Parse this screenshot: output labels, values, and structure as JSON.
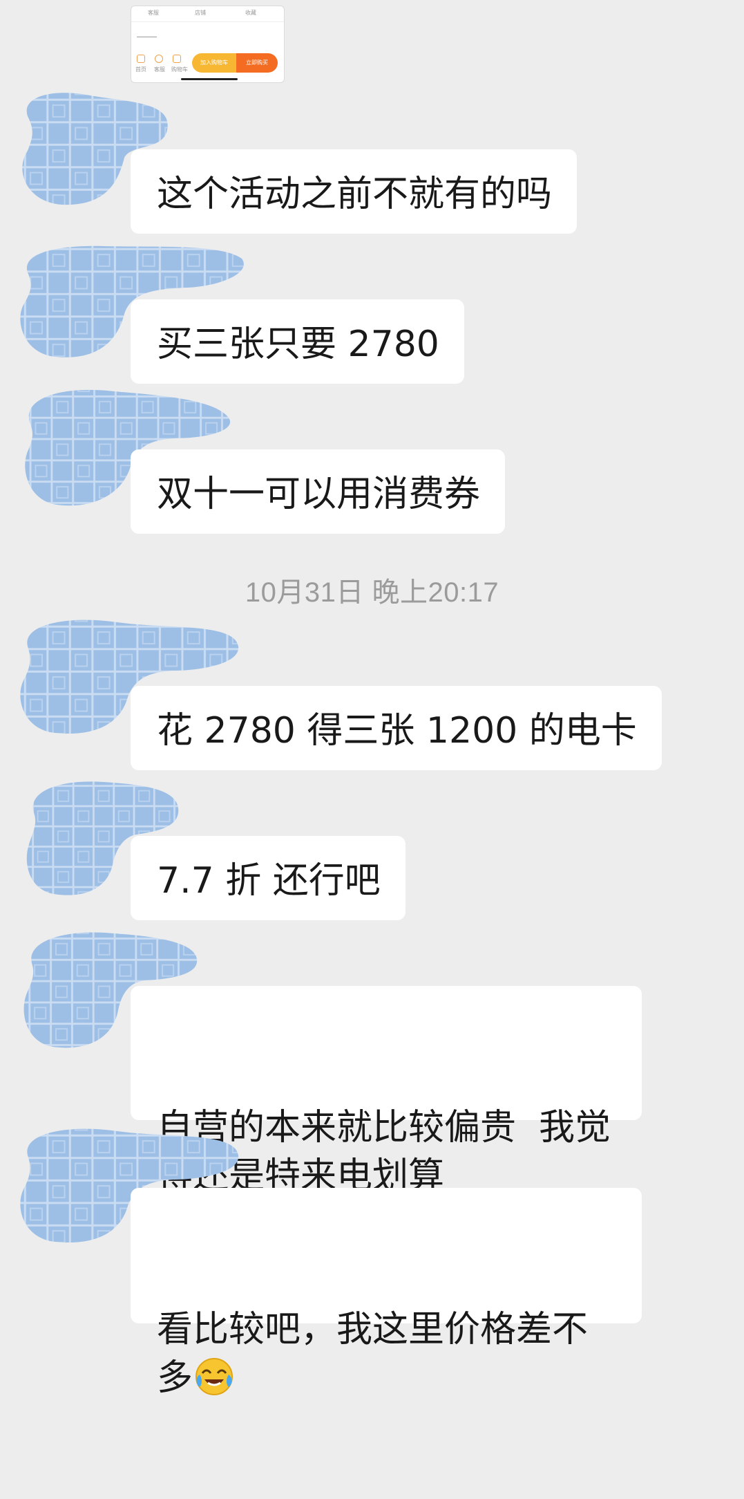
{
  "shared_card": {
    "row1": [
      "客服",
      "店铺",
      "收藏"
    ],
    "row2": [
      "首页",
      "客服",
      "购物车"
    ],
    "cart_button": "加入购物车",
    "buy_button": "立即购买"
  },
  "timestamp": "10月31日 晚上20:17",
  "messages": [
    {
      "text": "这个活动之前不就有的吗"
    },
    {
      "text": "买三张只要 2780"
    },
    {
      "text": "双十一可以用消费券"
    },
    {
      "text": "花 2780 得三张 1200 的电卡"
    },
    {
      "text": "7.7 折 还行吧"
    },
    {
      "text": "自营的本来就比较偏贵  我觉得还是特来电划算"
    },
    {
      "text": "看比较吧，我这里价格差不多",
      "emoji": "crying-laughing-face"
    }
  ],
  "colors": {
    "background": "#ededed",
    "bubble": "#ffffff",
    "text": "#191919",
    "timestamp": "#9b9b9b",
    "avatar_blur": "#9dbfe6"
  }
}
